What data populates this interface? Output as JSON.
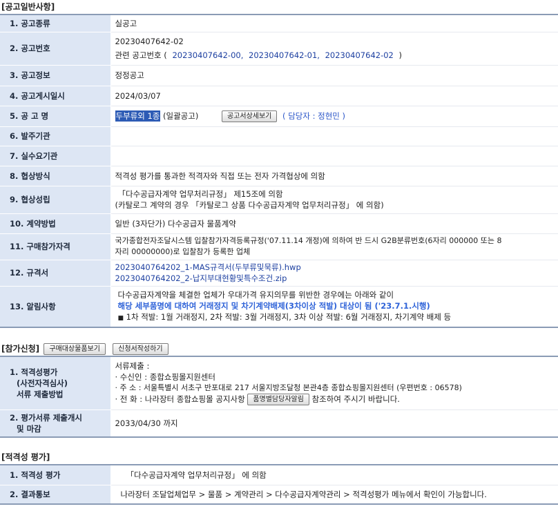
{
  "general": {
    "title": "[공고일반사항]",
    "rows": {
      "type": {
        "label": "1. 공고종류",
        "value": "실공고"
      },
      "number": {
        "label": "2. 공고번호",
        "value": "20230407642-02",
        "related_prefix": "관련 공고번호 (",
        "related": [
          "20230407642-00,",
          "20230407642-01,",
          "20230407642-02"
        ],
        "related_suffix": ")"
      },
      "info": {
        "label": "3. 공고정보",
        "value": "정정공고"
      },
      "date": {
        "label": "4. 공고게시일시",
        "value": "2024/03/07"
      },
      "name": {
        "label": "5. 공 고 명",
        "highlight": "두부류외 1종",
        "suffix": "(일괄공고)",
        "detail_button": "공고서상세보기",
        "manager": "( 담당자 : 정현민 )"
      },
      "org": {
        "label": "6. 발주기관",
        "value": ""
      },
      "demand": {
        "label": "7. 실수요기관",
        "value": ""
      },
      "method": {
        "label": "8. 협상방식",
        "value": "적격성 평가를 통과한 적격자와 직접 또는 전자 가격협상에 의함"
      },
      "establish": {
        "label": "9. 협상성립",
        "line1": "「다수공급자계약 업무처리규정」 제15조에 의함",
        "line2": "(카탈로그 계약의 경우 「카탈로그 상품 다수공급자계약 업무처리규정」 에 의함)"
      },
      "contract": {
        "label": "10. 계약방법",
        "value": "일반 (3자단가) 다수공급자 물품계약"
      },
      "qualification": {
        "label": "11. 구매참가자격",
        "line1": "국가종합전자조달시스템 입찰참가자격등록규정('07.11.14 개정)에 의하여 반 드시 G2B분류번호(6자리 000000 또는 8",
        "line2": "자리 00000000)로 입찰참가 등록한 업체"
      },
      "spec": {
        "label": "12. 규격서",
        "files": [
          "2023040764202_1-MAS규격서(두부류및묵류).hwp",
          "2023040764202_2-납지부대현황및특수조건.zip"
        ]
      },
      "notice": {
        "label": "13. 알림사항",
        "line1": "다수공급자계약을 체결한 업체가 우대가격 유지의무를 위반한 경우에는 아래와 같이",
        "line2": "해당 세부품명에 대하여 거래정지 및 차기계약배제(3차이상 적발) 대상이 됨 ('23.7.1.시행)",
        "line3_mark": "■",
        "line3": "1차 적발: 1월 거래정지, 2차 적발: 3월 거래정지, 3차 이상 적발: 6월 거래정지, 차기계약 배제 등"
      }
    }
  },
  "participation": {
    "title": "[참가신청]",
    "buttons": {
      "view_items": "구매대상물품보기",
      "write_application": "신청서작성하기"
    },
    "rows": {
      "submit": {
        "label1": "1. 적격성평가",
        "label2": "(사전자격심사)",
        "label3": "서류 제출방법",
        "line1": "서류제출 :",
        "line2": "· 수신인 : 종합쇼핑몰지원센터",
        "line3": "· 주 소 : 서울특별시 서초구 반포대로 217 서울지방조달청 본관4층 종합쇼핑몰지원센터 (우편번호 : 06578)",
        "line4_prefix": "· 전 화 : 나라장터 종합쇼핑몰 공지사항",
        "line4_button": "품명별담당자알림",
        "line4_suffix": "참조하여 주시기 바랍니다."
      },
      "deadline": {
        "label1": "2. 평가서류 제출개시",
        "label2": "및 마감",
        "value": "2033/04/30 까지"
      }
    }
  },
  "evaluation": {
    "title": "[적격성 평가]",
    "rows": {
      "eval": {
        "label": "1. 적격성 평가",
        "value": "「다수공급자계약 업무처리규정」 에 의함"
      },
      "result": {
        "label": "2. 결과통보",
        "value": "나라장터 조달업체업무 > 물품 > 계약관리 > 다수공급자계약관리 > 적격성평가 메뉴에서 확인이 가능합니다."
      }
    }
  },
  "colors": {
    "header_bg": "#dde6f4",
    "link": "#1c3fa0",
    "notice": "#2f63d8",
    "highlight": "#2d5bb5"
  }
}
